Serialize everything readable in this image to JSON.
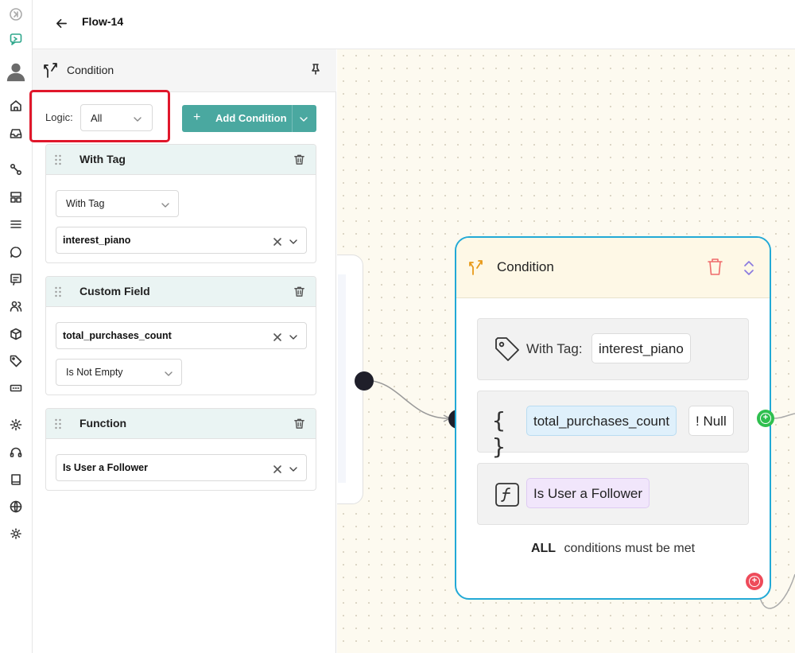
{
  "header": {
    "title": "Flow-14"
  },
  "rail": {
    "icons": [
      "collapse-icon",
      "chat-bot-icon",
      "avatar",
      "home-icon",
      "inbox-icon",
      "flows-icon",
      "templates-icon",
      "list-icon",
      "chat-bubble-icon",
      "message-icon",
      "contacts-icon",
      "package-icon",
      "tag-icon",
      "ticket-icon",
      "settings-icon",
      "headset-icon",
      "book-icon",
      "globe-icon",
      "theme-icon"
    ]
  },
  "panel": {
    "title": "Condition",
    "logic": {
      "label": "Logic:",
      "value": "All"
    },
    "add_condition_label": "Add Condition",
    "cards": [
      {
        "title": "With Tag",
        "type_value": "With Tag",
        "value": "interest_piano"
      },
      {
        "title": "Custom Field",
        "field_value": "total_purchases_count",
        "operator_value": "Is Not Empty"
      },
      {
        "title": "Function",
        "value": "Is User a Follower"
      }
    ]
  },
  "node": {
    "title": "Condition",
    "rows": [
      {
        "label": "With Tag:",
        "value": "interest_piano"
      },
      {
        "label": "{ }",
        "field": "total_purchases_count",
        "operator": "! Null"
      },
      {
        "value": "Is User a Follower"
      }
    ],
    "footer_strong": "ALL",
    "footer_text": "conditions must be met"
  },
  "colors": {
    "accent": "#4aa8a0",
    "node_border": "#22a9d6",
    "highlight": "#e0172b",
    "true_handle": "#2fbf4f",
    "false_handle": "#ee4b5a"
  }
}
